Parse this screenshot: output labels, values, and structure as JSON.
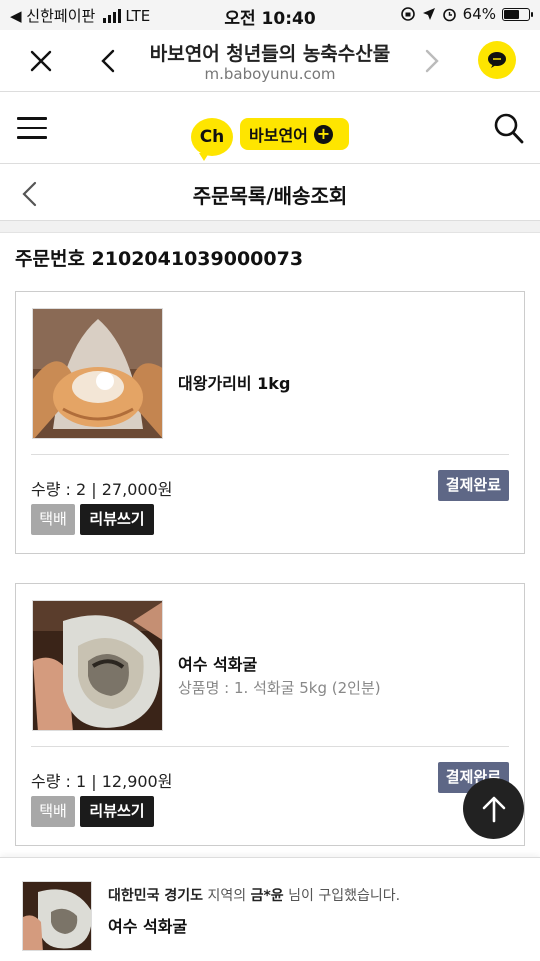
{
  "status_bar": {
    "carrier": "◀ 신한페이판",
    "network": "LTE",
    "time": "오전 10:40",
    "battery": "64%",
    "battery_level": 0.64
  },
  "browser": {
    "title": "바보연어 청년들의 농축수산물",
    "url": "m.baboyunu.com"
  },
  "header": {
    "ch_label": "Ch",
    "channel_name": "바보연어"
  },
  "page": {
    "title": "주문목록/배송조회",
    "order_number_label": "주문번호 2102041039000073"
  },
  "orders": [
    {
      "name": "대왕가리비 1kg",
      "option": "",
      "qty_price": "수량 : 2 | 27,000원",
      "status": "결제완료",
      "courier": "택배",
      "review": "리뷰쓰기"
    },
    {
      "name": "여수 석화굴",
      "option": "상품명 : 1. 석화굴 5kg (2인분)",
      "qty_price": "수량 : 1 | 12,900원",
      "status": "결제완료",
      "courier": "택배",
      "review": "리뷰쓰기"
    }
  ],
  "toast": {
    "region": "대한민국 경기도",
    "text1": " 지역의 ",
    "buyer": "금*윤",
    "text2": " 님이 구입했습니다.",
    "product": "여수 석화굴"
  },
  "colors": {
    "kakao_yellow": "#fee500",
    "status_badge": "#5e6786",
    "review_button": "#1b1b1b",
    "courier_tag": "#a8a8a8"
  },
  "icons": [
    "close-icon",
    "chevron-left-icon",
    "chevron-right-icon",
    "kakaotalk-icon",
    "menu-icon",
    "search-icon",
    "plus-icon",
    "arrow-up-icon"
  ]
}
